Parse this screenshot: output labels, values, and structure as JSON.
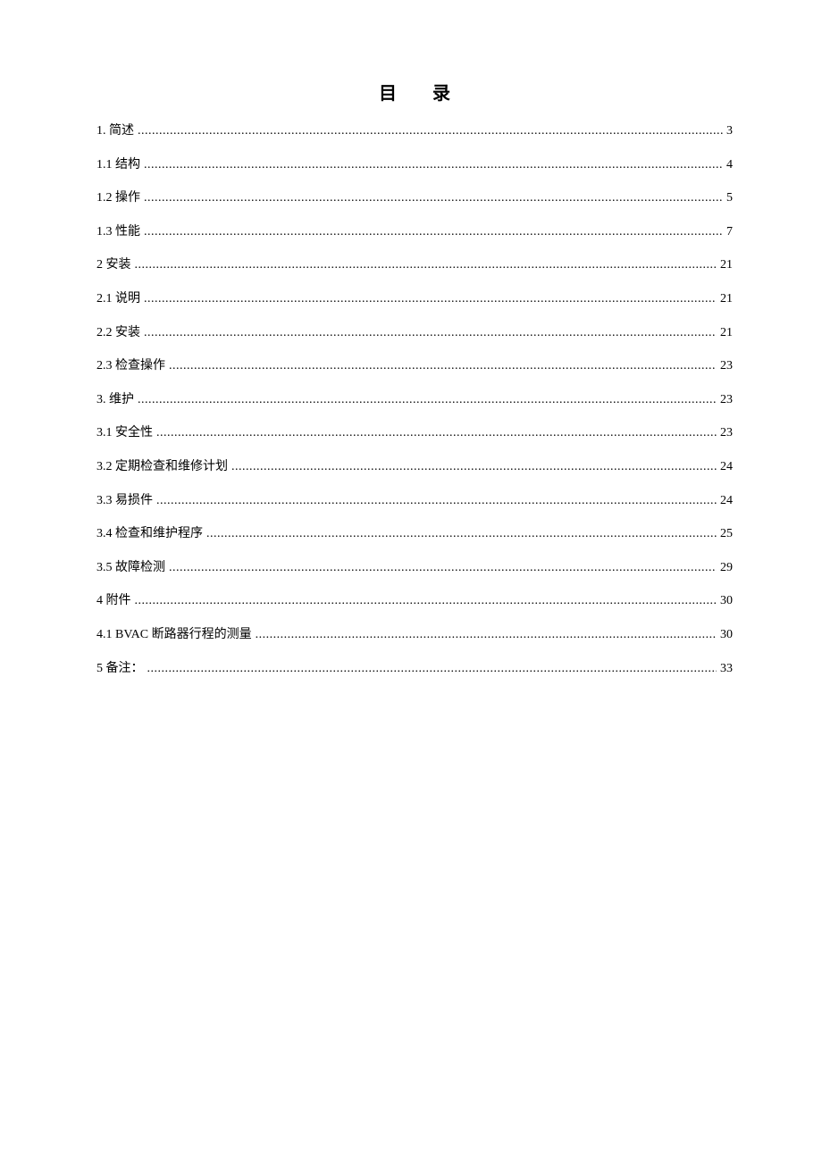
{
  "title": "目录",
  "toc": [
    {
      "label": "1. 简述",
      "page": "3"
    },
    {
      "label": "1.1 结构",
      "page": "4"
    },
    {
      "label": "1.2 操作",
      "page": "5"
    },
    {
      "label": "1.3 性能",
      "page": "7"
    },
    {
      "label": "2 安装",
      "page": "21"
    },
    {
      "label": "2.1 说明",
      "page": "21"
    },
    {
      "label": "2.2 安装",
      "page": "21"
    },
    {
      "label": "2.3 检查操作",
      "page": "23"
    },
    {
      "label": "3. 维护",
      "page": "23"
    },
    {
      "label": "3.1 安全性",
      "page": "23"
    },
    {
      "label": "3.2 定期检查和维修计划",
      "page": "24"
    },
    {
      "label": "3.3 易损件",
      "page": "24"
    },
    {
      "label": "3.4 检查和维护程序",
      "page": "25"
    },
    {
      "label": "3.5 故障检测",
      "page": "29"
    },
    {
      "label": "4 附件",
      "page": "30"
    },
    {
      "label": "4.1 BVAC 断路器行程的测量",
      "page": "30"
    },
    {
      "label": "5 备注：",
      "page": "33"
    }
  ]
}
